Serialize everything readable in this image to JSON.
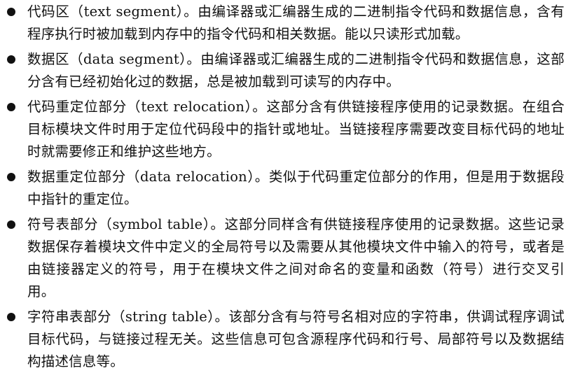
{
  "items": [
    {
      "text": "代码区（text segment）。由编译器或汇编器生成的二进制指令代码和数据信息，含有程序执行时被加载到内存中的指令代码和相关数据。能以只读形式加载。"
    },
    {
      "text": "数据区（data segment）。由编译器或汇编器生成的二进制指令代码和数据信息，这部分含有已经初始化过的数据，总是被加载到可读写的内存中。"
    },
    {
      "text": "代码重定位部分（text relocation）。这部分含有供链接程序使用的记录数据。在组合目标模块文件时用于定位代码段中的指针或地址。当链接程序需要改变目标代码的地址时就需要修正和维护这些地方。"
    },
    {
      "text": "数据重定位部分（data relocation）。类似于代码重定位部分的作用，但是用于数据段中指针的重定位。"
    },
    {
      "text": "符号表部分（symbol table）。这部分同样含有供链接程序使用的记录数据。这些记录数据保存着模块文件中定义的全局符号以及需要从其他模块文件中输入的符号，或者是由链接器定义的符号，用于在模块文件之间对命名的变量和函数（符号）进行交叉引用。"
    },
    {
      "text": "字符串表部分（string table）。该部分含有与符号名相对应的字符串，供调试程序调试目标代码，与链接过程无关。这些信息可包含源程序代码和行号、局部符号以及数据结构描述信息等。"
    }
  ]
}
